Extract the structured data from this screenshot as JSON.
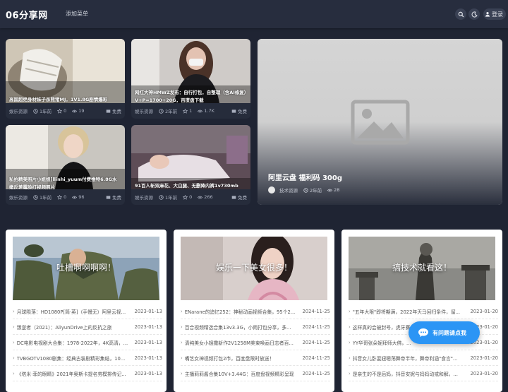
{
  "header": {
    "logo": "06分享网",
    "menu_add": "添加菜单",
    "login": "登录"
  },
  "cards": [
    {
      "title": "高国超绝身材妹子杀熊猪MJ，1V1.8G剧情爆彩",
      "category": "娱乐资源",
      "time": "1年前",
      "likes": "0",
      "views": "19",
      "price": "免费"
    },
    {
      "title": "网红大神HMWZ发布：自行打包，自整理（含AI修复）V+P=1700+20G，百度盘下载",
      "category": "娱乐资源",
      "time": "2年前",
      "likes": "1",
      "views": "1.7K",
      "price": "免费"
    },
    {
      "title": "私拍精美照片小姐姐[llinhi_yuum付费推特6.8G水嫩反差露脸打视频照片",
      "category": "娱乐资源",
      "time": "1年前",
      "likes": "0",
      "views": "96",
      "price": "免费"
    },
    {
      "title": "91百人斩双麻花、大白腿、无删降内裤1v730mb",
      "category": "娱乐资源",
      "time": "1年前",
      "likes": "0",
      "views": "266",
      "price": "免费"
    }
  ],
  "feature": {
    "title": "阿里云盘 福利码 300g",
    "category": "技术资源",
    "time": "2年前",
    "views": "28"
  },
  "boxes": [
    {
      "caption": "吐槽啊啊啊啊！",
      "items": [
        {
          "t": "月球陨落：HD1080P[简·英]（手慢无）阿里云视...",
          "d": "2023-01-13"
        },
        {
          "t": "叛逆者（2021）：AliyunDrive上的反抗之旅",
          "d": "2023-01-13"
        },
        {
          "t": "DC电影电视剧大合集：1978-2022年，4K高清，...",
          "d": "2023-01-13"
        },
        {
          "t": "TVBGOTV1080剧集：经典古装剧精彩集结，10...",
          "d": "2023-01-13"
        },
        {
          "t": "《塔米·菲的眼睛》2021年奥斯卡提名劳模排传记...",
          "d": "2023-01-13"
        }
      ]
    },
    {
      "caption": "娱乐一下美女很多！",
      "items": [
        {
          "t": "ENarane的追忆252：神秘动画视频合集，95个2...",
          "d": "2024-11-25"
        },
        {
          "t": "百合视频精选合集13v3.3G，小雨打包分享，多...",
          "d": "2024-11-25"
        },
        {
          "t": "清纯美女小姐撒新作2V1258M美束唤画日志者百...",
          "d": "2024-11-25"
        },
        {
          "t": "嘴艺女神视频打包2市，百度盘限时放送！",
          "d": "2024-11-25"
        },
        {
          "t": "主播莉莉酱合集10V+3.44G：百度盘视频精彩呈现",
          "d": "2024-11-25"
        }
      ]
    },
    {
      "caption": "搞技术就看这！",
      "items": [
        {
          "t": "\"五年大限\"即将期满，2022年天马回归条件，留...",
          "d": "2023-01-20"
        },
        {
          "t": "这样真的会被封号，虎牙赛...",
          "d": "2023-01-20"
        },
        {
          "t": "YY华哥张朵妮拜师大佛，...",
          "d": "2023-01-20"
        },
        {
          "t": "抖音女儿卧耍妞嗯荡舞帝半年，舞帝利涵\"食言\"...",
          "d": "2023-01-20"
        },
        {
          "t": "是亲生的不是后妈，抖音安妮与妈妈动或和解，...",
          "d": "2023-01-20"
        }
      ]
    }
  ],
  "help": "有问题请点我"
}
